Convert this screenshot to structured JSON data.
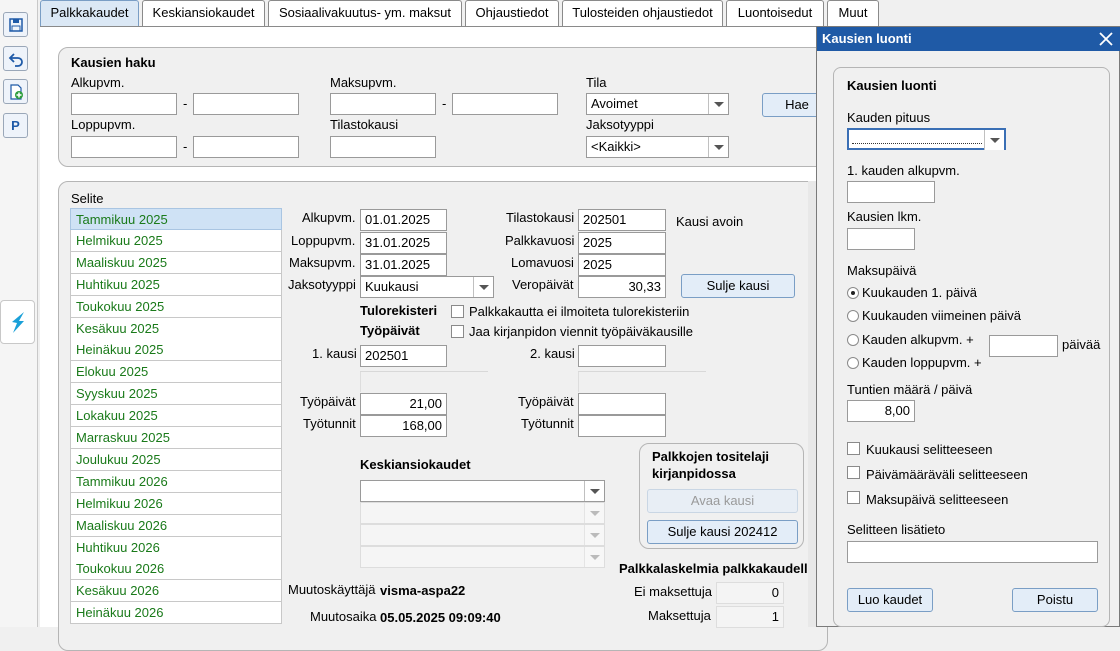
{
  "toolbar": {
    "items": [
      {
        "icon": "save-icon"
      },
      {
        "icon": "undo-icon"
      },
      {
        "icon": "new-document-icon"
      },
      {
        "label": "P"
      }
    ]
  },
  "tabs": [
    "Palkkakaudet",
    "Keskiansiokaudet",
    "Sosiaalivakuutus- ym. maksut",
    "Ohjaustiedot",
    "Tulosteiden ohjaustiedot",
    "Luontoisedut",
    "Muut"
  ],
  "search": {
    "title": "Kausien haku",
    "alkupvm_label": "Alkupvm.",
    "loppupvm_label": "Loppupvm.",
    "maksupvm_label": "Maksupvm.",
    "tilastokausi_label": "Tilastokausi",
    "tila_label": "Tila",
    "tila_value": "Avoimet",
    "jaksotyyppi_label": "Jaksotyyppi",
    "jaksotyyppi_value": "<Kaikki>",
    "dash": "-",
    "search_button": "Hae"
  },
  "periods": {
    "title": "Selite",
    "items": [
      "Tammikuu 2025",
      "Helmikuu 2025",
      "Maaliskuu 2025",
      "Huhtikuu 2025",
      "Toukokuu 2025",
      "Kesäkuu 2025",
      "Heinäkuu 2025",
      "Elokuu 2025",
      "Syyskuu 2025",
      "Lokakuu 2025",
      "Marraskuu 2025",
      "Joulukuu 2025",
      "Tammikuu 2026",
      "Helmikuu 2026",
      "Maaliskuu 2026",
      "Huhtikuu 2026",
      "Toukokuu 2026",
      "Kesäkuu 2026",
      "Heinäkuu 2026"
    ]
  },
  "detail": {
    "alkupvm_label": "Alkupvm.",
    "alkupvm": "01.01.2025",
    "loppupvm_label": "Loppupvm.",
    "loppupvm": "31.01.2025",
    "maksupvm_label": "Maksupvm.",
    "maksupvm": "31.01.2025",
    "jaksotyyppi_label": "Jaksotyyppi",
    "jaksotyyppi": "Kuukausi",
    "tilastokausi_label": "Tilastokausi",
    "tilastokausi": "202501",
    "palkkavuosi_label": "Palkkavuosi",
    "palkkavuosi": "2025",
    "lomavuosi_label": "Lomavuosi",
    "lomavuosi": "2025",
    "veropaivat_label": "Veropäivät",
    "veropaivat": "30,33",
    "status": "Kausi avoin",
    "close_button": "Sulje kausi",
    "tulorekisteri_label": "Tulorekisteri",
    "tyopaivat_heading": "Työpäivät",
    "chk_tulorekisteri": "Palkkakautta ei ilmoiteta tulorekisteriin",
    "chk_jaa": "Jaa kirjanpidon viennit työpäiväkausille",
    "kausi1_label": "1. kausi",
    "kausi1": "202501",
    "kausi2_label": "2. kausi",
    "kausi2": "",
    "tyopaivat_label": "Työpäivät",
    "tyopaivat1": "21,00",
    "tyopaivat2": "",
    "tyotunnit_label": "Työtunnit",
    "tyotunnit1": "168,00",
    "tyotunnit2": "",
    "keskiansio_label": "Keskiansiokaudet",
    "voucher_title": "Palkkojen tositelaji kirjanpidossa",
    "open_period_button": "Avaa kausi",
    "close_period_button": "Sulje kausi 202412",
    "muutoskayttaja_label": "Muutoskäyttäjä",
    "muutoskayttaja": "visma-aspa22",
    "muutosaika_label": "Muutosaika",
    "muutosaika": "05.05.2025 09:09:40",
    "payslips_title": "Palkkalaskelmia palkkakaudella",
    "ei_maksettuja_label": "Ei maksettuja",
    "ei_maksettuja": "0",
    "maksettuja_label": "Maksettuja",
    "maksettuja": "1"
  },
  "dialog": {
    "title": "Kausien luonti",
    "heading": "Kausien luonti",
    "kauden_pituus_label": "Kauden pituus",
    "kauden_pituus": "",
    "alkupvm_label": "1. kauden alkupvm.",
    "alkupvm": "",
    "lkm_label": "Kausien lkm.",
    "lkm": "",
    "maksupaiva_label": "Maksupäivä",
    "radio1": "Kuukauden 1. päivä",
    "radio2": "Kuukauden viimeinen päivä",
    "radio3": "Kauden alkupvm. +",
    "radio4": "Kauden loppupvm. +",
    "days_suffix": "päivää",
    "days": "",
    "tunnit_label": "Tuntien määrä / päivä",
    "tunnit": "8,00",
    "chk1": "Kuukausi selitteeseen",
    "chk2": "Päivämääräväli selitteeseen",
    "chk3": "Maksupäivä selitteeseen",
    "lisatieto_label": "Selitteen lisätieto",
    "lisatieto": "",
    "create_button": "Luo kaudet",
    "delete_button": "Poistu"
  }
}
